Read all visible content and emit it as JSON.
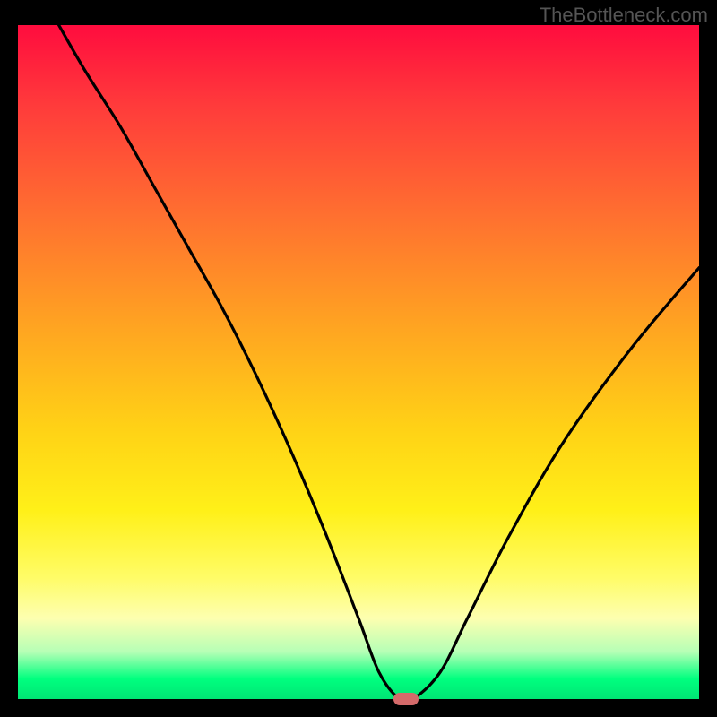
{
  "watermark": "TheBottleneck.com",
  "chart_data": {
    "type": "line",
    "title": "",
    "xlabel": "",
    "ylabel": "",
    "xlim": [
      0,
      100
    ],
    "ylim": [
      0,
      100
    ],
    "series": [
      {
        "name": "curve",
        "x": [
          6,
          10,
          15,
          20,
          25,
          30,
          35,
          40,
          45,
          50,
          53,
          56,
          58,
          62,
          66,
          72,
          80,
          90,
          100
        ],
        "values": [
          100,
          93,
          85,
          76,
          67,
          58,
          48,
          37,
          25,
          12,
          4,
          0,
          0,
          4,
          12,
          24,
          38,
          52,
          64
        ]
      }
    ],
    "marker": {
      "x": 57,
      "y": 0
    },
    "background_gradient": {
      "top": "#ff0c3e",
      "bottom": "#00e574"
    }
  }
}
